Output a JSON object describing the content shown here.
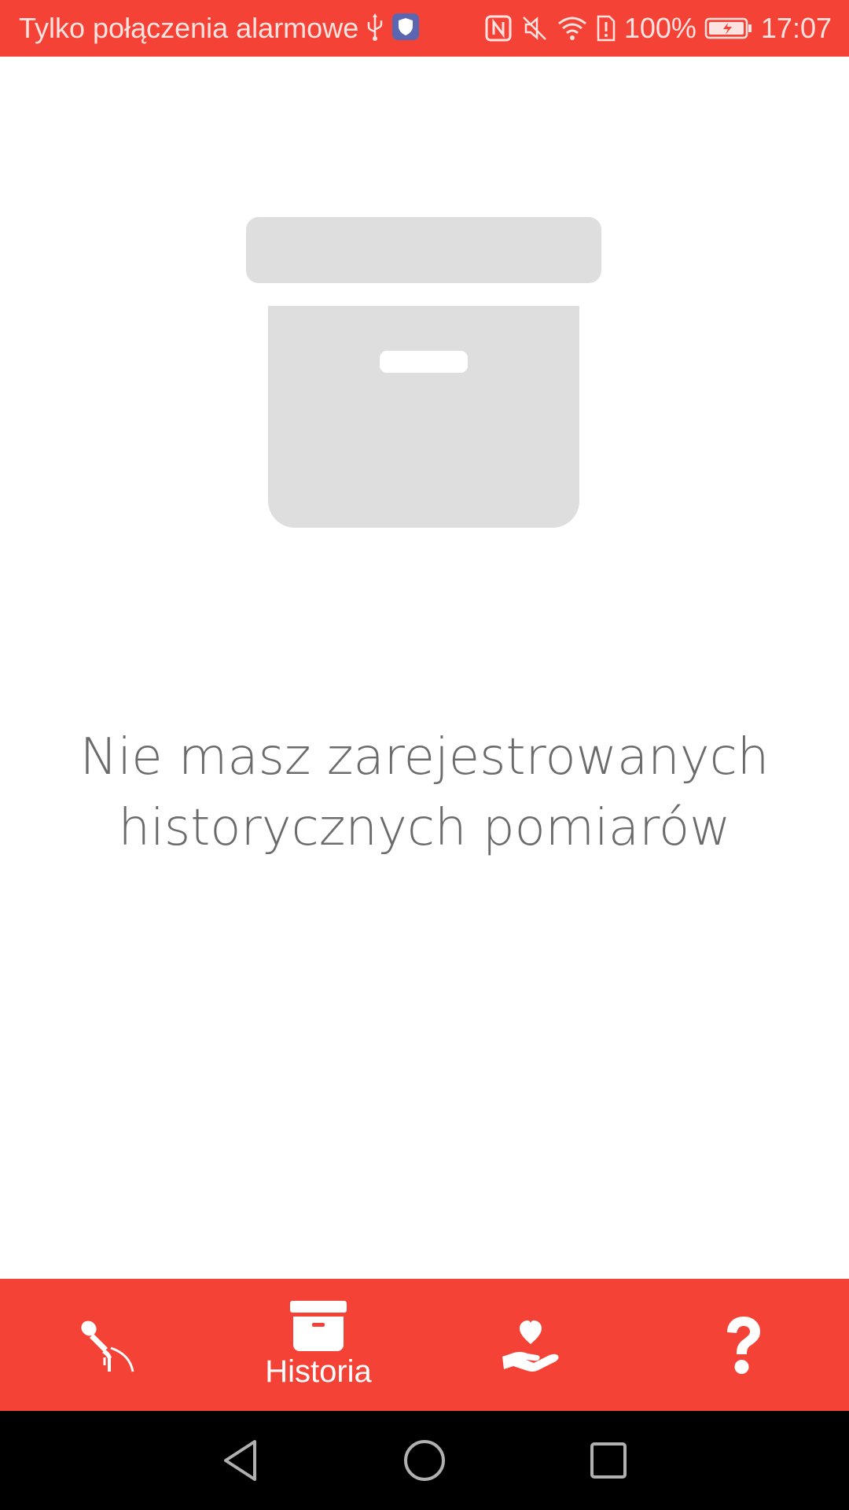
{
  "status_bar": {
    "carrier_text": "Tylko połączenia alarmowe",
    "battery_percent": "100%",
    "time": "17:07",
    "icons": [
      "usb-icon",
      "shield-icon",
      "nfc-icon",
      "muted-icon",
      "wifi-icon",
      "sim-alert-icon",
      "battery-charging-icon"
    ]
  },
  "empty_state": {
    "icon": "archive-box-icon",
    "message_line1": "Nie masz zarejestrowanych",
    "message_line2": "historycznych pomiarów"
  },
  "bottom_nav": {
    "items": [
      {
        "icon": "microphone-icon",
        "label": ""
      },
      {
        "icon": "archive-icon",
        "label": "Historia",
        "selected": true
      },
      {
        "icon": "hand-heart-icon",
        "label": ""
      },
      {
        "icon": "question-icon",
        "label": ""
      }
    ]
  },
  "system_nav": {
    "icons": [
      "back-icon",
      "home-icon",
      "recents-icon"
    ]
  },
  "colors": {
    "accent": "#f44336",
    "placeholder_gray": "#dedede",
    "message_text": "#6b6b6b"
  }
}
